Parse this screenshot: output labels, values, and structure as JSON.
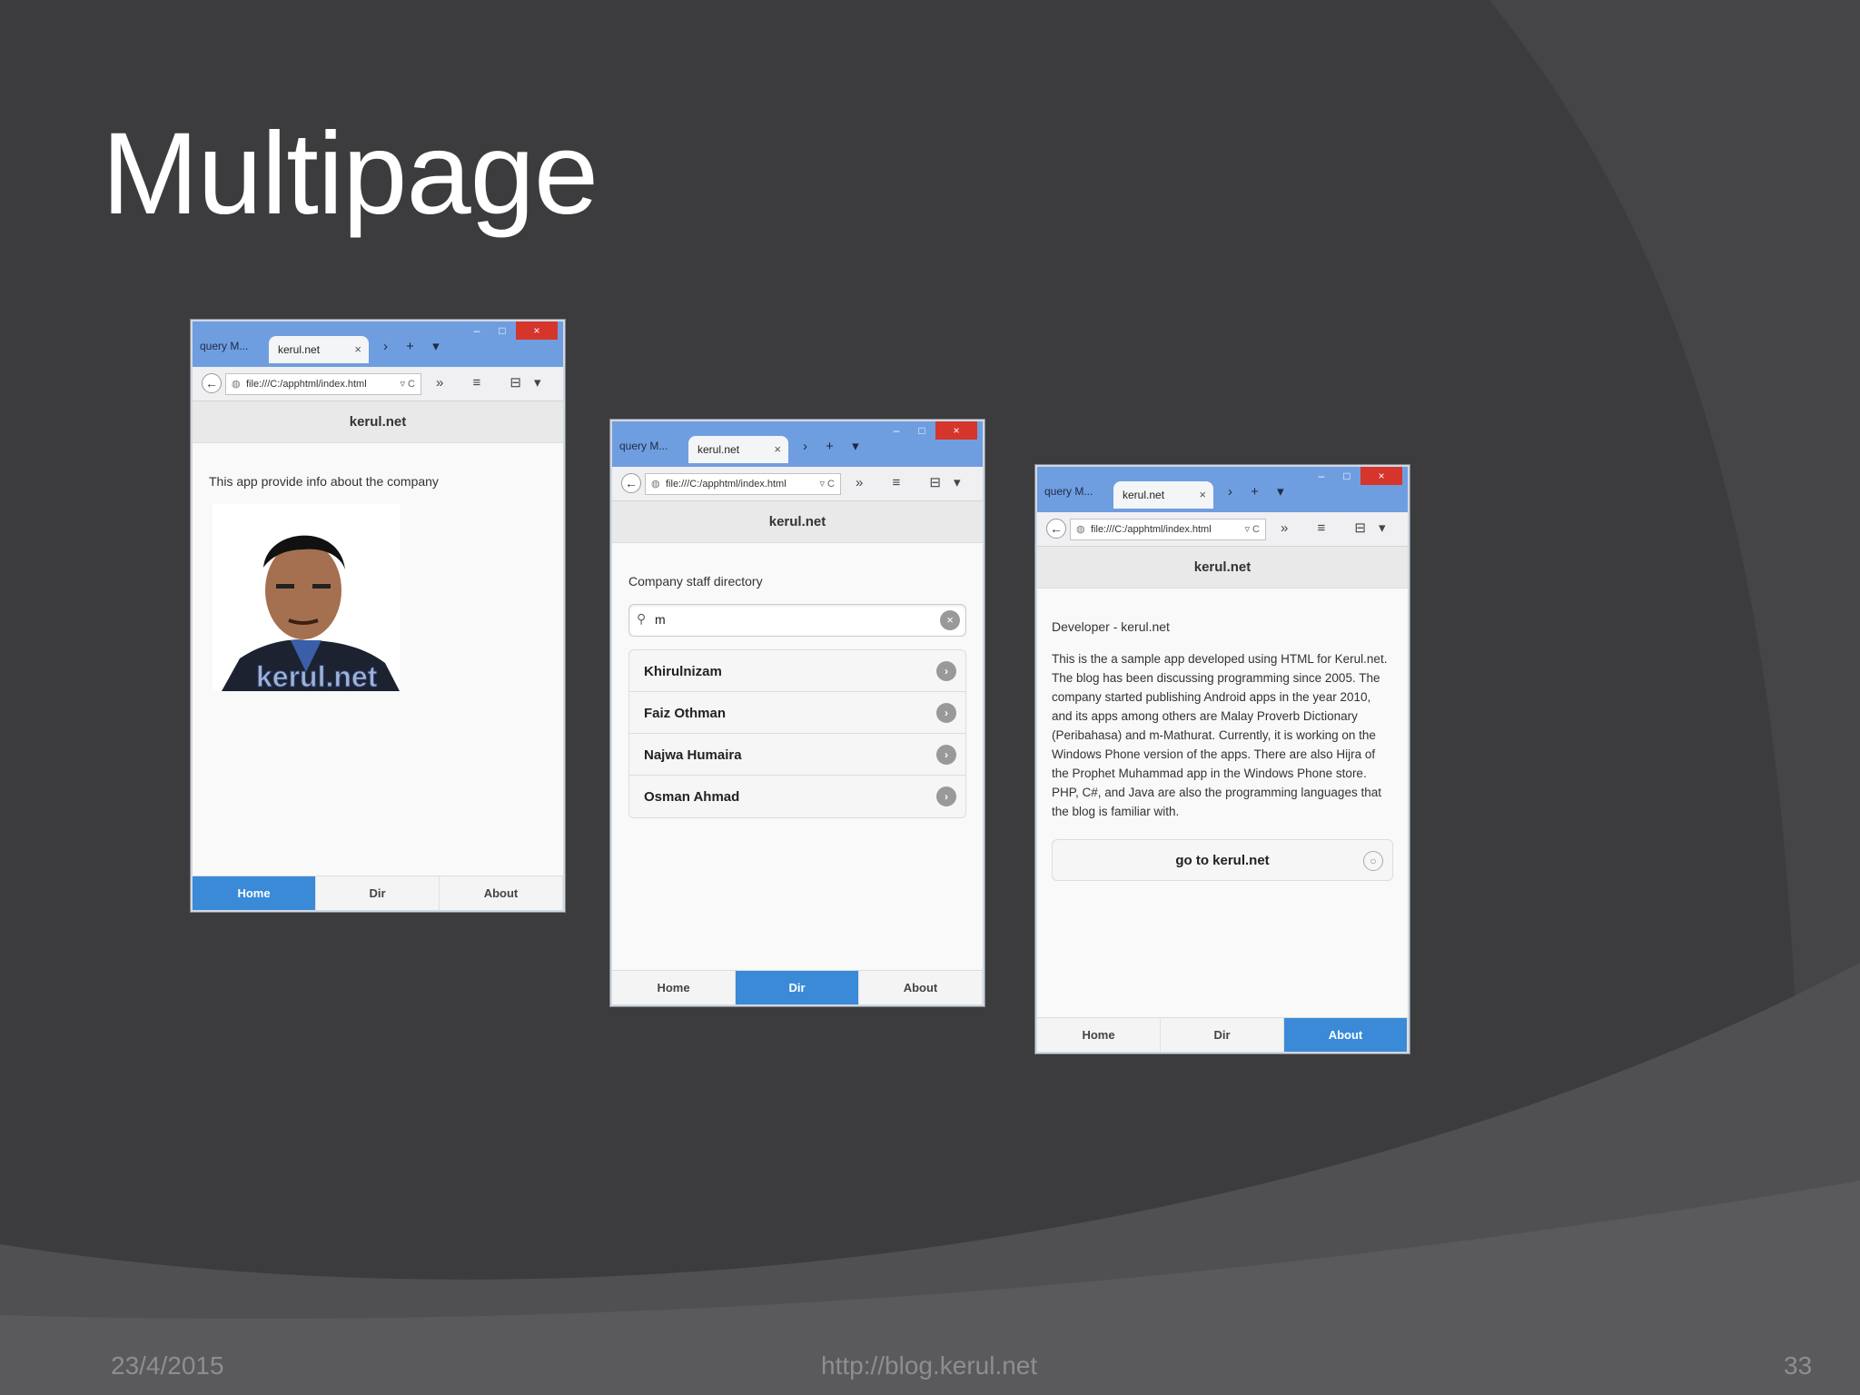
{
  "slide": {
    "title": "Multipage",
    "footer_date": "23/4/2015",
    "footer_url": "http://blog.kerul.net",
    "page_number": "33"
  },
  "browser": {
    "tab_left": "query M...",
    "tab_active": "kerul.net",
    "tab_close": "×",
    "tab_new": "› + ▾",
    "win_min": "–",
    "win_max": "□",
    "win_close": "×",
    "back": "←",
    "url": "file:///C:/apphtml/index.html",
    "reload": "▿ C",
    "tools": "» ≡ ⊟▾"
  },
  "app": {
    "header_title": "kerul.net",
    "nav": {
      "home": "Home",
      "dir": "Dir",
      "about": "About"
    }
  },
  "home_page": {
    "intro": "This app provide info about the company",
    "photo_watermark": "kerul.net"
  },
  "dir_page": {
    "heading": "Company staff directory",
    "search_value": "m",
    "staff": [
      "Khirulnizam",
      "Faiz Othman",
      "Najwa Humaira",
      "Osman Ahmad"
    ]
  },
  "about_page": {
    "heading": "Developer - kerul.net",
    "description": "This is the a sample app developed using HTML for Kerul.net. The blog has been discussing programming since 2005. The company started publishing Android apps in the year 2010, and its apps among others are Malay Proverb Dictionary (Peribahasa) and m-Mathurat. Currently, it is working on the Windows Phone version of the apps. There are also Hijra of the Prophet Muhammad app in the Windows Phone store. PHP, C#, and Java are also the programming languages that the blog is familiar with.",
    "button_label": "go to kerul.net"
  },
  "colors": {
    "background": "#3c3c3e",
    "browser_chrome": "#6f9ee0",
    "active_nav": "#3a8ad8",
    "close_button": "#d6352c"
  }
}
